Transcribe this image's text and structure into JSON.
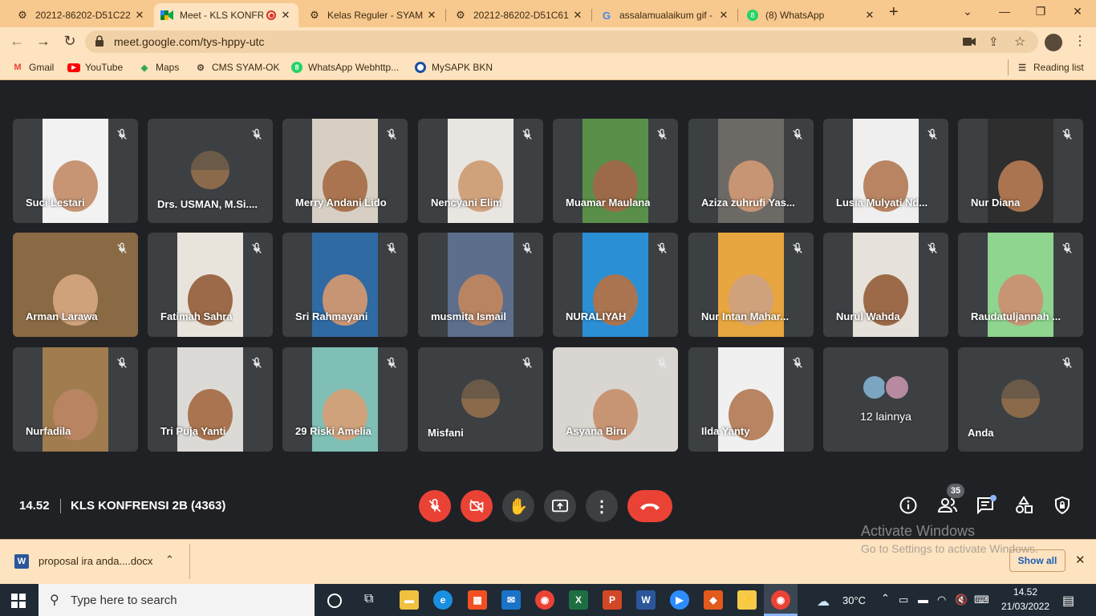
{
  "tabs": [
    {
      "label": "20212-86202-D51C22",
      "icon": "syam-icon"
    },
    {
      "label": "Meet - KLS KONFR",
      "icon": "meet-icon",
      "active": true,
      "recording": true
    },
    {
      "label": "Kelas Reguler - SYAM",
      "icon": "syam-icon"
    },
    {
      "label": "20212-86202-D51C61",
      "icon": "syam-icon"
    },
    {
      "label": "assalamualaikum gif -",
      "icon": "google-icon"
    },
    {
      "label": "(8) WhatsApp",
      "icon": "whatsapp-icon"
    }
  ],
  "new_tab": "+",
  "url": "meet.google.com/tys-hppy-utc",
  "bookmarks": [
    {
      "label": "Gmail",
      "icon": "gmail-icon"
    },
    {
      "label": "YouTube",
      "icon": "youtube-icon"
    },
    {
      "label": "Maps",
      "icon": "maps-icon"
    },
    {
      "label": "CMS SYAM-OK",
      "icon": "syam-icon"
    },
    {
      "label": "WhatsApp Webhttp...",
      "icon": "whatsapp-icon"
    },
    {
      "label": "MySAPK BKN",
      "icon": "bkn-icon"
    }
  ],
  "reading_list": "Reading list",
  "participants": [
    {
      "name": "Suci Lestari",
      "type": "video",
      "bg": "#f2f2f2"
    },
    {
      "name": "Drs. USMAN, M.Si....",
      "type": "avatar",
      "bg": "#3c4043"
    },
    {
      "name": "Merry Andani Lido",
      "type": "video",
      "bg": "#d8cfc4"
    },
    {
      "name": "Nencyani Elim",
      "type": "video",
      "bg": "#e9e6e1"
    },
    {
      "name": "Muamar Maulana",
      "type": "video",
      "bg": "#5a8f4a"
    },
    {
      "name": "Aziza zuhrufi Yas...",
      "type": "video",
      "bg": "#6d6a66"
    },
    {
      "name": "Lusia Mulyati Nd...",
      "type": "video",
      "bg": "#efefef"
    },
    {
      "name": "Nur Diana",
      "type": "video",
      "bg": "#2e2e2e"
    },
    {
      "name": "Arman Larawa",
      "type": "video",
      "bg": "#8a6a44"
    },
    {
      "name": "Fatimah Sahra",
      "type": "video",
      "bg": "#e8e4dc"
    },
    {
      "name": "Sri Rahmayani",
      "type": "video",
      "bg": "#2f6aa3"
    },
    {
      "name": "musmita Ismail",
      "type": "video",
      "bg": "#5c6e8c"
    },
    {
      "name": "NURALIYAH",
      "type": "video",
      "bg": "#2b8fd6"
    },
    {
      "name": "Nur Intan Mahar...",
      "type": "video",
      "bg": "#e8a640"
    },
    {
      "name": "Nurul Wahda",
      "type": "video",
      "bg": "#e6e1da"
    },
    {
      "name": "Raudatuljannah ...",
      "type": "video",
      "bg": "#8fd48f"
    },
    {
      "name": "Nurfadila",
      "type": "video",
      "bg": "#a07c4e"
    },
    {
      "name": "Tri Puja Yanti",
      "type": "video",
      "bg": "#dcdad6"
    },
    {
      "name": "29 Riski Amelia",
      "type": "video",
      "bg": "#7fbfb5"
    },
    {
      "name": "Misfani",
      "type": "avatar",
      "bg": "#3c4043"
    },
    {
      "name": "Asyana Biru",
      "type": "video",
      "bg": "#d9d6d2"
    },
    {
      "name": "Ilda Yanty",
      "type": "video",
      "bg": "#f0f0f0"
    },
    {
      "name": "12 lainnya",
      "type": "others",
      "bg": "#3c4043"
    },
    {
      "name": "Anda",
      "type": "avatar",
      "bg": "#3c4043"
    }
  ],
  "meeting": {
    "time": "14.52",
    "title": "KLS KONFRENSI 2B (4363)",
    "participant_count": "35"
  },
  "download": {
    "file": "proposal ira anda....docx",
    "show_all": "Show all"
  },
  "watermark": {
    "title": "Activate Windows",
    "subtitle": "Go to Settings to activate Windows."
  },
  "taskbar": {
    "search_placeholder": "Type here to search",
    "weather": "30°C",
    "time": "14.52",
    "date": "21/03/2022"
  },
  "colors": {
    "end_call": "#ea4335",
    "tab_strip": "#f8c98f",
    "toolbar": "#fde3c0"
  }
}
